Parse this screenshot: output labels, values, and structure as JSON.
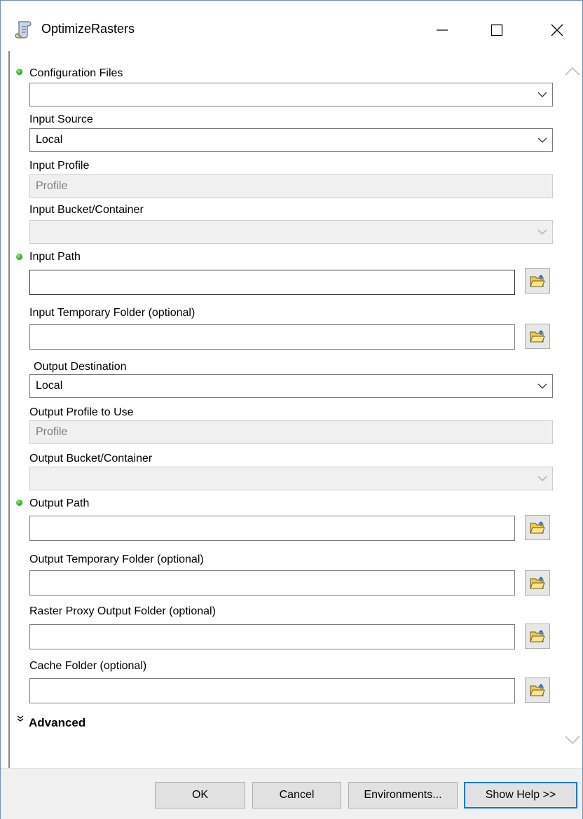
{
  "window": {
    "title": "OptimizeRasters"
  },
  "fields": {
    "config_files": {
      "label": "Configuration Files",
      "value": ""
    },
    "input_source": {
      "label": "Input Source",
      "value": "Local"
    },
    "input_profile": {
      "label": "Input Profile",
      "placeholder": "Profile"
    },
    "input_bucket": {
      "label": "Input Bucket/Container",
      "value": ""
    },
    "input_path": {
      "label": "Input Path",
      "value": ""
    },
    "input_temp": {
      "label": "Input Temporary Folder (optional)",
      "value": ""
    },
    "output_destination": {
      "label": "Output Destination",
      "value": "Local"
    },
    "output_profile": {
      "label": "Output Profile to Use",
      "placeholder": "Profile"
    },
    "output_bucket": {
      "label": "Output Bucket/Container",
      "value": ""
    },
    "output_path": {
      "label": "Output Path",
      "value": ""
    },
    "output_temp": {
      "label": "Output Temporary Folder (optional)",
      "value": ""
    },
    "raster_proxy": {
      "label": "Raster Proxy Output Folder (optional)",
      "value": ""
    },
    "cache_folder": {
      "label": "Cache Folder (optional)",
      "value": ""
    }
  },
  "advanced": {
    "label": "Advanced",
    "icon": "double-chevron-down-icon"
  },
  "buttons": {
    "ok": "OK",
    "cancel": "Cancel",
    "environments": "Environments...",
    "show_help": "Show Help >>"
  },
  "icons": {
    "app": "tool-scroll-icon",
    "browse": "folder-open-icon",
    "required": "green-dot-icon"
  },
  "colors": {
    "required_dot": "#19a519",
    "folder_icon": "#f2c94c",
    "focus_border": "#0078d7"
  }
}
